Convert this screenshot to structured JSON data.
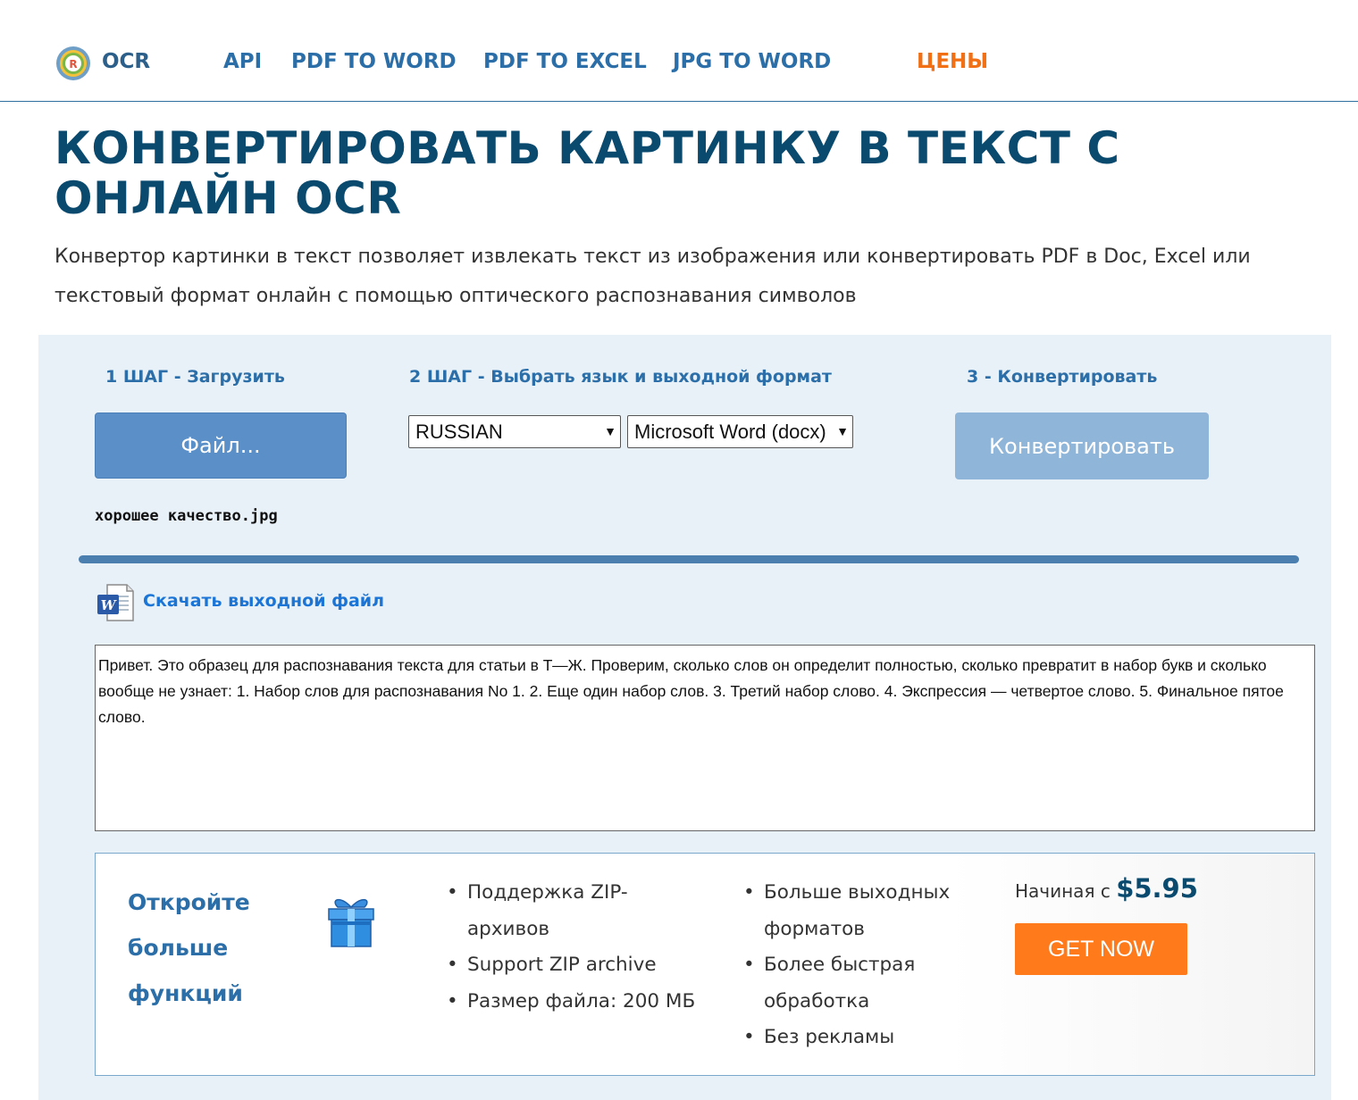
{
  "header": {
    "logo_text": "OCR",
    "nav": {
      "api": "API",
      "pdf_to_word": "PDF TO WORD",
      "pdf_to_excel": "PDF TO EXCEL",
      "jpg_to_word": "JPG TO WORD",
      "prices": "ЦЕНЫ"
    }
  },
  "page": {
    "title": "КОНВЕРТИРОВАТЬ КАРТИНКУ В ТЕКСТ С ОНЛАЙН OCR",
    "subtitle": "Конвертор картинки в текст позволяет извлекать текст из изображения или конвертировать PDF в Doc, Excel или текстовый формат онлайн с помощью оптического распознавания символов"
  },
  "converter": {
    "step1_label": "1 ШАГ - Загрузить",
    "step2_label": "2 ШАГ - Выбрать язык и выходной формат",
    "step3_label": "3 - Конвертировать",
    "file_button_label": "Файл...",
    "file_name": "хорошее качество.jpg",
    "language_selected": "RUSSIAN",
    "format_selected": "Microsoft Word (docx)",
    "convert_button_label": "Конвертировать",
    "progress_fraction": 1.0,
    "download_link": "Скачать выходной файл",
    "result_text": "Привет. Это образец для распознавания текста для статьи в Т—Ж. Проверим, сколько слов он определит полностью, сколько превратит в набор букв и сколько вообще не узнает: 1. Набор слов для распознавания No 1. 2. Еще один набор слов. 3. Третий набор слово. 4. Экспрессия — четвертое слово. 5. Финальное пятое слово."
  },
  "promo": {
    "title": "Откройте больше функций",
    "features_a": [
      "Поддержка ZIP-архивов",
      "Support ZIP archive",
      "Размер файла: 200 МБ"
    ],
    "features_b": [
      "Больше выходных форматов",
      "Более быстрая обработка",
      "Без рекламы"
    ],
    "price_prefix": "Начиная с",
    "price_value": "$5.95",
    "cta_label": "GET NOW"
  },
  "colors": {
    "brand_dark": "#0a4a6e",
    "link_blue": "#2c6fa8",
    "accent_orange": "#ff7a1a",
    "panel_bg": "#e8f0f8"
  },
  "icons": {
    "logo": "ocr-logo-icon",
    "download": "word-document-icon",
    "gift": "gift-icon"
  }
}
